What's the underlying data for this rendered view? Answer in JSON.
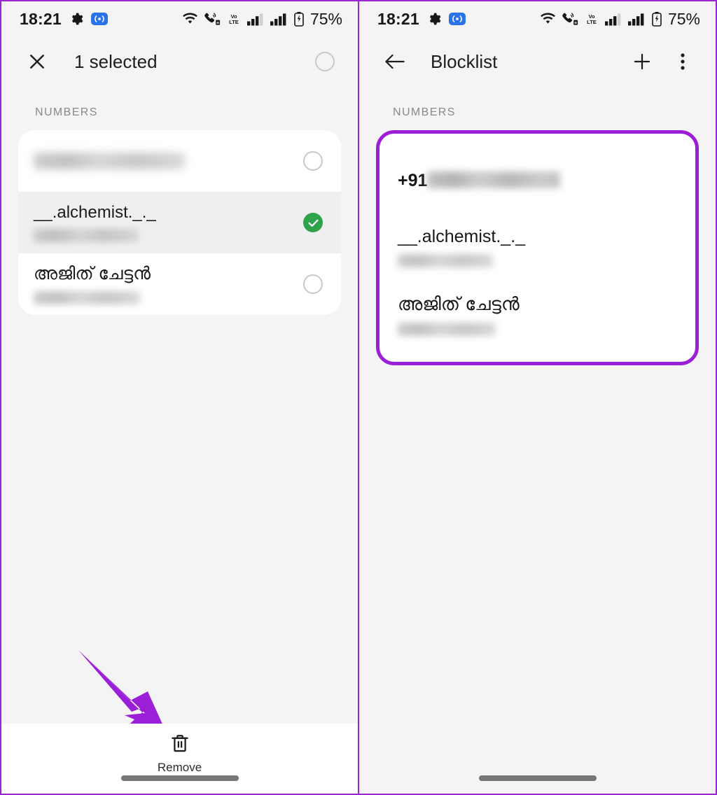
{
  "statusbar": {
    "time": "18:21",
    "battery_percent": "75%",
    "icons": [
      "gear-icon",
      "hotspot-icon",
      "wifi-icon",
      "volte-call-icon",
      "vo-lte-icon",
      "signal-bars-sim1-icon",
      "signal-bars-sim2-icon",
      "battery-icon"
    ]
  },
  "colors": {
    "accent_purple": "#9b1fd6",
    "check_green": "#2ea34c",
    "hotspot_blue": "#2a72e8",
    "background": "#f4f4f4",
    "card": "#ffffff"
  },
  "left_panel": {
    "appbar": {
      "close_label": "close-icon",
      "title": "1 selected",
      "select_all_label": "select-all-circle"
    },
    "section_label": "NUMBERS",
    "rows": [
      {
        "name": "",
        "name_blurred": true,
        "subtitle": "",
        "subtitle_blurred": false,
        "selected": false
      },
      {
        "name": "__.alchemist._._",
        "name_blurred": false,
        "subtitle": "",
        "subtitle_blurred": true,
        "selected": true
      },
      {
        "name": "അജിത് ചേട്ടൻ",
        "name_blurred": false,
        "subtitle": "",
        "subtitle_blurred": true,
        "selected": false
      }
    ],
    "bottom_action": {
      "icon": "trash-icon",
      "label": "Remove"
    }
  },
  "right_panel": {
    "appbar": {
      "back_label": "back-arrow-icon",
      "title": "Blocklist",
      "add_label": "plus-icon",
      "overflow_label": "more-vertical-icon"
    },
    "section_label": "NUMBERS",
    "rows": [
      {
        "name": "+91",
        "name_suffix_blurred": true,
        "subtitle": "",
        "subtitle_blurred": false
      },
      {
        "name": "__.alchemist._._",
        "name_suffix_blurred": false,
        "subtitle": "",
        "subtitle_blurred": true
      },
      {
        "name": "അജിത് ചേട്ടൻ",
        "name_suffix_blurred": false,
        "subtitle": "",
        "subtitle_blurred": true
      }
    ],
    "highlight_box": true
  },
  "annotation": {
    "arrow_color": "#9b1fd6",
    "points_to": "Remove"
  }
}
